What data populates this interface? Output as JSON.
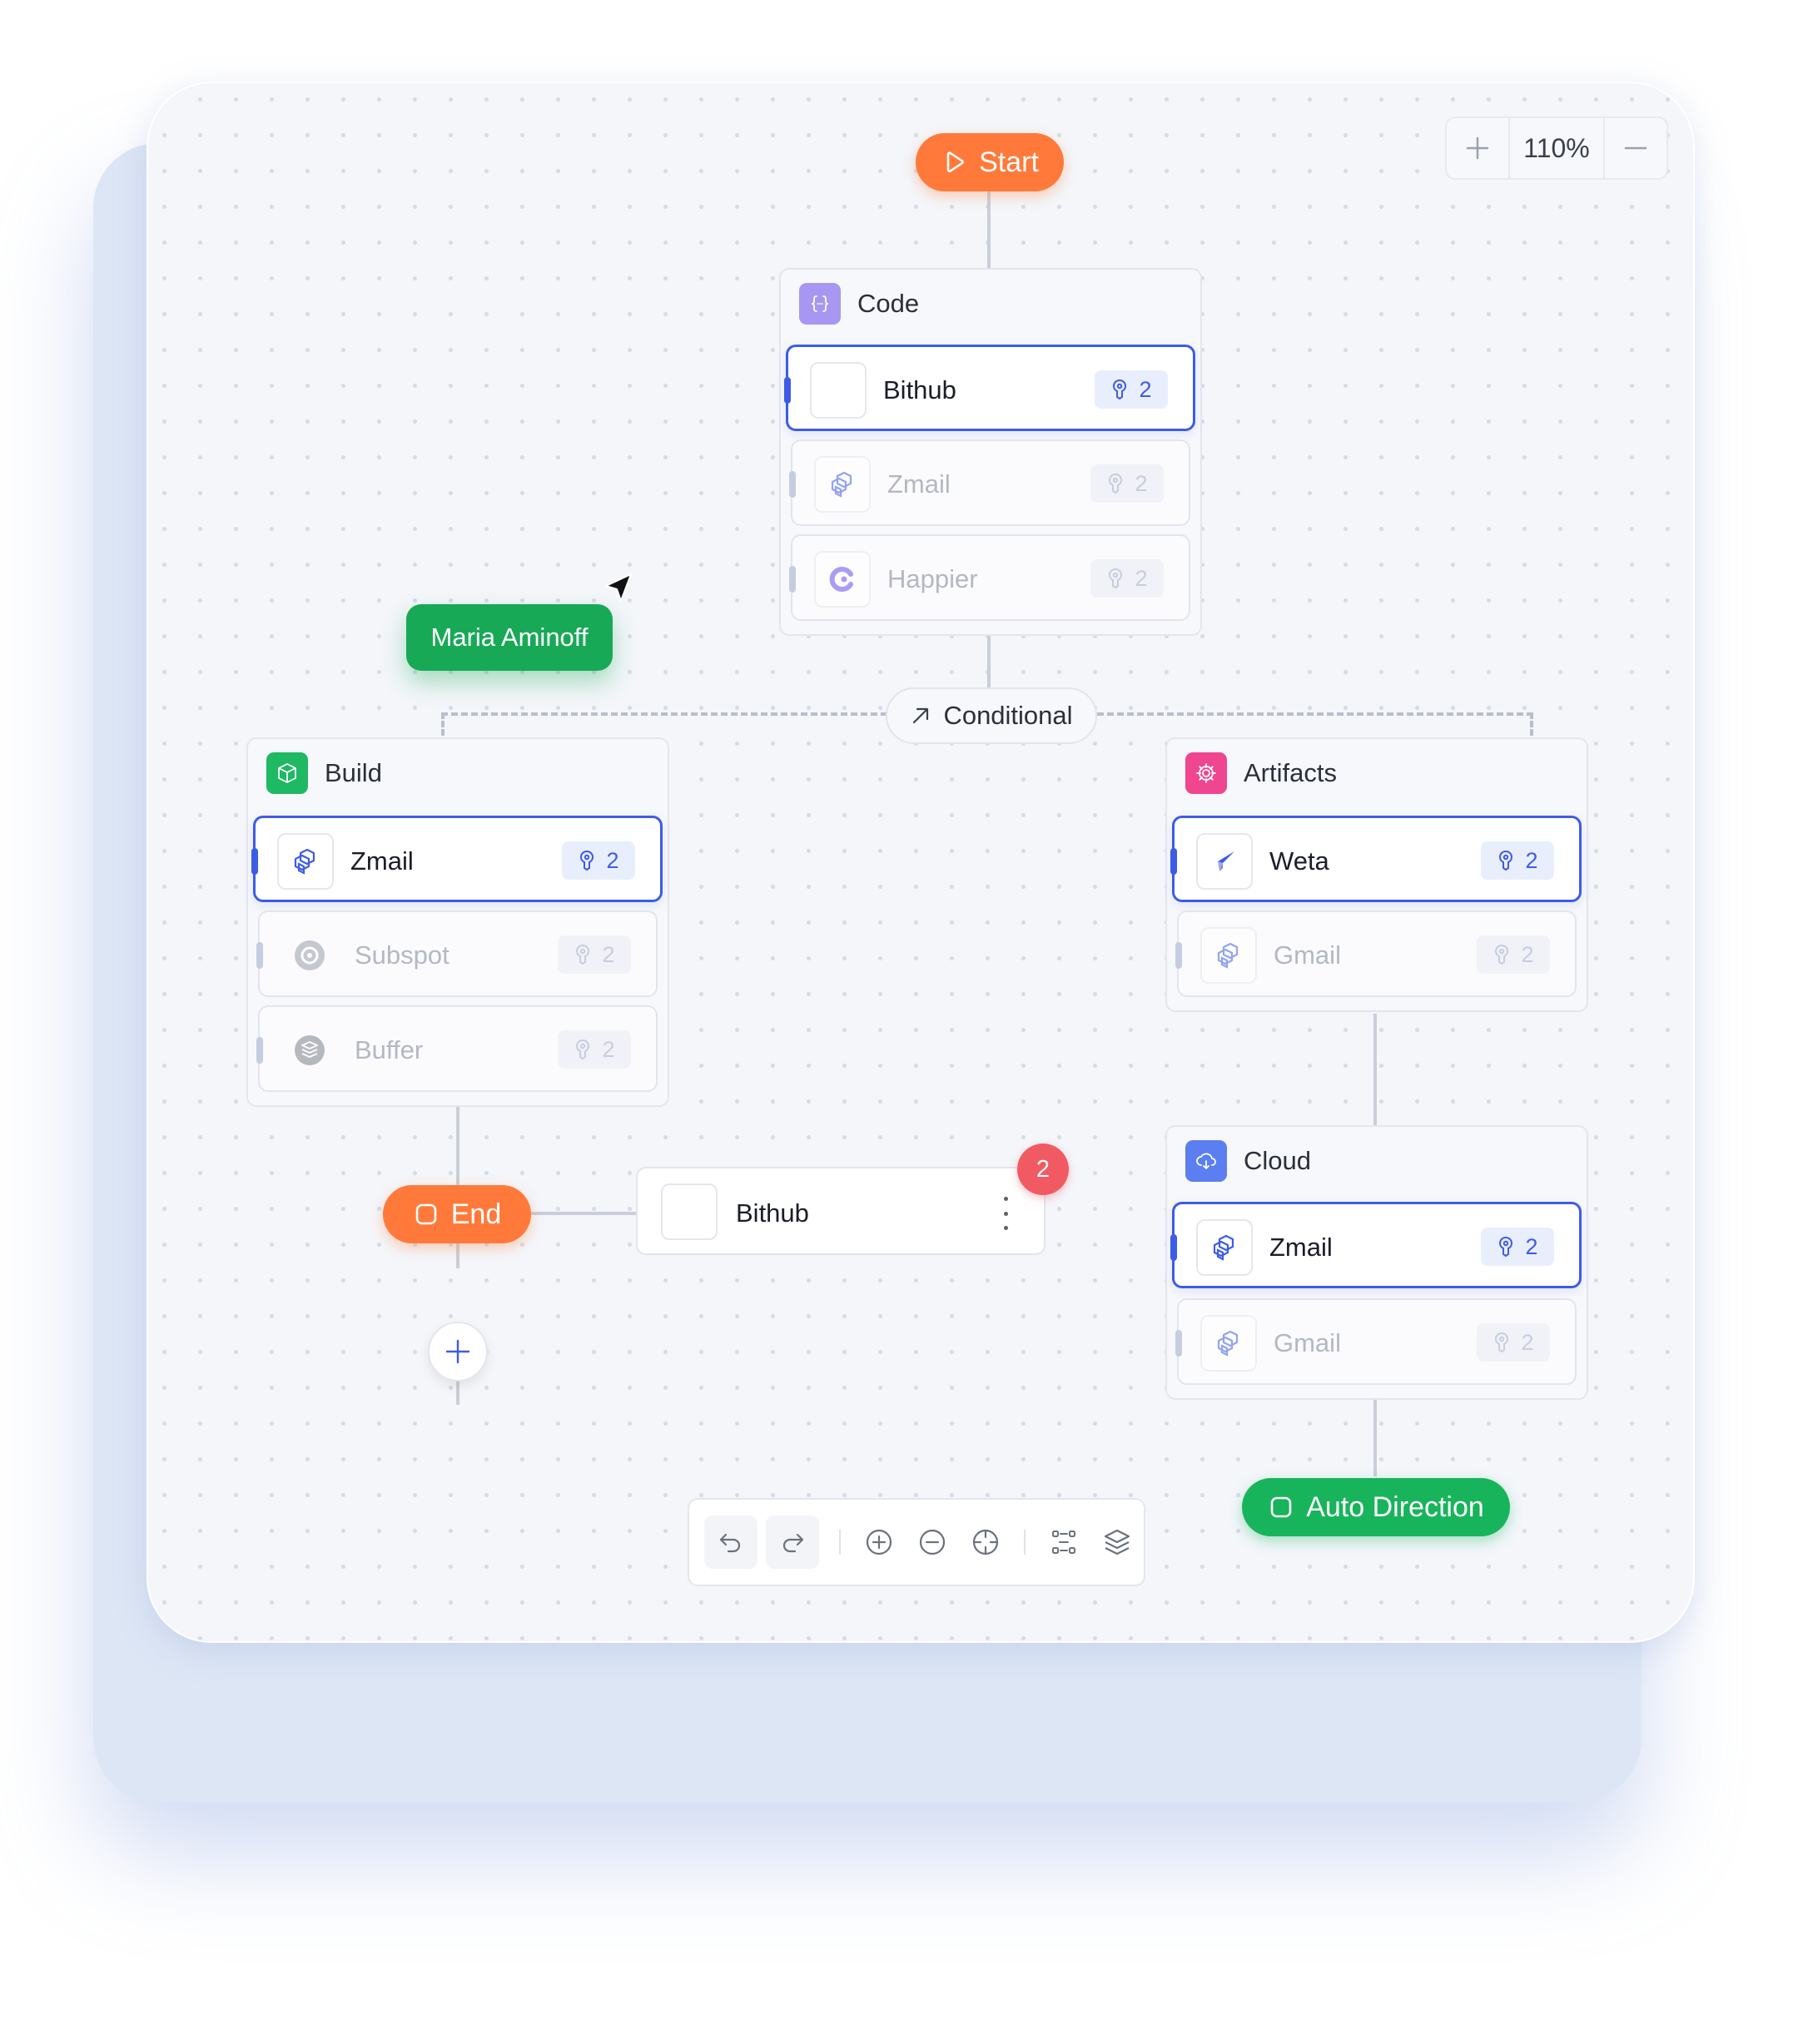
{
  "zoom": {
    "plus_icon": "plus-icon",
    "level": "110%",
    "minus_icon": "minus-icon"
  },
  "start": {
    "label": "Start",
    "icon": "play-icon"
  },
  "end": {
    "label": "End",
    "icon": "square-icon"
  },
  "auto_direction": {
    "label": "Auto Direction",
    "icon": "square-icon"
  },
  "conditional": {
    "label": "Conditional",
    "icon": "arrow-up-right-icon"
  },
  "collaborator": {
    "name": "Maria Aminoff",
    "cursor_icon": "cursor-arrow-icon"
  },
  "groups": {
    "code": {
      "title": "Code",
      "icon": "code-braces-icon",
      "color": "#9b8cf0",
      "items": [
        {
          "label": "Bithub",
          "count": "2",
          "active": true,
          "icon": "blank"
        },
        {
          "label": "Zmail",
          "count": "2",
          "active": false,
          "icon": "stack-cube-icon"
        },
        {
          "label": "Happier",
          "count": "2",
          "active": false,
          "icon": "happier-logo-icon"
        }
      ]
    },
    "build": {
      "title": "Build",
      "icon": "box-icon",
      "color": "#1fb863",
      "items": [
        {
          "label": "Zmail",
          "count": "2",
          "active": true,
          "icon": "stack-cube-icon"
        },
        {
          "label": "Subspot",
          "count": "2",
          "active": false,
          "icon": "subspot-logo-icon"
        },
        {
          "label": "Buffer",
          "count": "2",
          "active": false,
          "icon": "buffer-logo-icon"
        }
      ]
    },
    "artifacts": {
      "title": "Artifacts",
      "icon": "gear-cog-icon",
      "color": "#f0458f",
      "items": [
        {
          "label": "Weta",
          "count": "2",
          "active": true,
          "icon": "weta-logo-icon"
        },
        {
          "label": "Gmail",
          "count": "2",
          "active": false,
          "icon": "stack-cube-icon"
        }
      ]
    },
    "cloud": {
      "title": "Cloud",
      "icon": "cloud-icon",
      "color": "#5b7ff0",
      "items": [
        {
          "label": "Zmail",
          "count": "2",
          "active": true,
          "icon": "stack-cube-icon"
        },
        {
          "label": "Gmail",
          "count": "2",
          "active": false,
          "icon": "stack-cube-icon"
        }
      ]
    }
  },
  "standalone_node": {
    "label": "Bithub",
    "notification_count": "2",
    "menu_icon": "kebab-vertical-icon"
  },
  "add_node": {
    "icon": "plus-icon"
  },
  "toolbar": {
    "tools": [
      "undo-icon",
      "redo-icon",
      "zoom-in-icon",
      "zoom-out-icon",
      "crosshair-icon",
      "fit-view-icon",
      "layers-icon"
    ]
  },
  "colors": {
    "accent": "#3d5ce6",
    "orange": "#ff7a3a",
    "green": "#18b45b",
    "badge_red": "#f25a63"
  }
}
